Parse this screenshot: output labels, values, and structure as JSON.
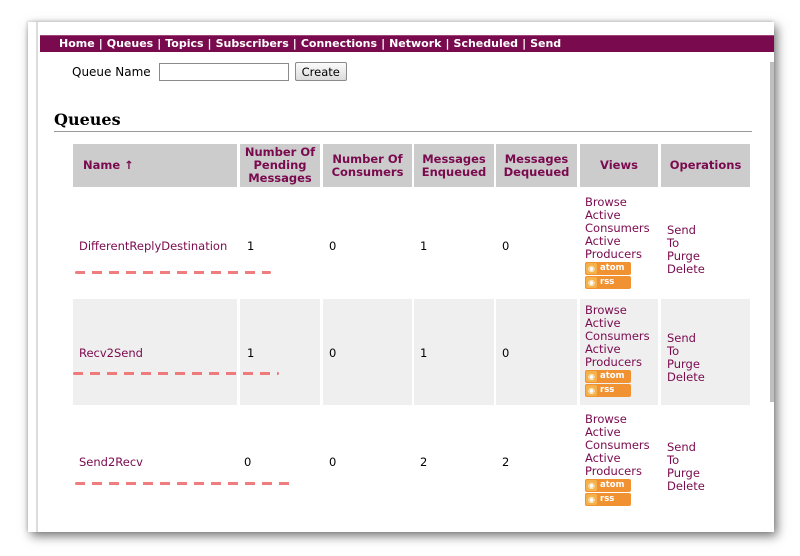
{
  "nav": [
    "Home",
    "Queues",
    "Topics",
    "Subscribers",
    "Connections",
    "Network",
    "Scheduled",
    "Send"
  ],
  "form": {
    "label": "Queue Name",
    "input_value": "",
    "button": "Create"
  },
  "section_title": "Queues",
  "table": {
    "headers": [
      "Name ↑",
      "Number Of Pending Messages",
      "Number Of Consumers",
      "Messages Enqueued",
      "Messages Dequeued",
      "Views",
      "Operations"
    ],
    "rows": [
      {
        "name": "DifferentReplyDestination",
        "pending": "1",
        "consumers": "0",
        "enqueued": "1",
        "dequeued": "0"
      },
      {
        "name": "Recv2Send",
        "pending": "1",
        "consumers": "0",
        "enqueued": "1",
        "dequeued": "0"
      },
      {
        "name": "Send2Recv",
        "pending": "0",
        "consumers": "0",
        "enqueued": "2",
        "dequeued": "2"
      }
    ],
    "views_links": [
      "Browse",
      "Active Consumers",
      "Active Producers"
    ],
    "feed_links": [
      "atom",
      "rss"
    ],
    "operations_links": [
      "Send To",
      "Purge",
      "Delete"
    ]
  },
  "colors": {
    "accent": "#7a0a4e",
    "header_bg": "#cccccc",
    "row_alt_bg": "#efefef",
    "feed": "#f09232",
    "annotation": "#ee6666"
  }
}
